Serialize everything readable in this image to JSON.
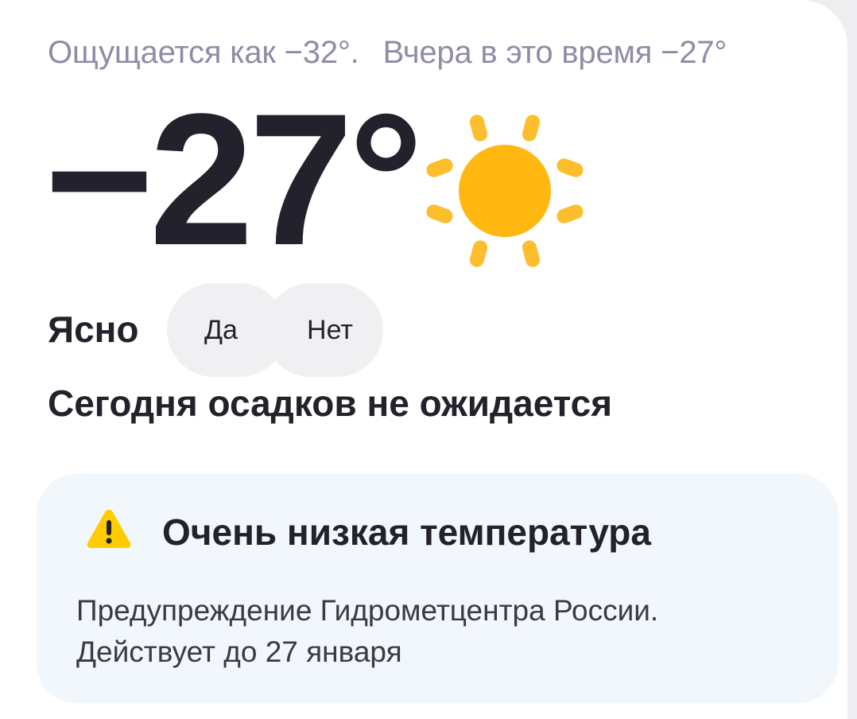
{
  "header": {
    "feels_like": "Ощущается как −32°.",
    "yesterday": "Вчера в это время −27°"
  },
  "current": {
    "temperature": "−27°",
    "condition": "Ясно",
    "icon": "sun-icon",
    "precipitation": "Сегодня осадков не ожидается"
  },
  "feedback": {
    "yes_label": "Да",
    "no_label": "Нет"
  },
  "alert": {
    "icon": "warning-icon",
    "title": "Очень низкая температура",
    "line1": "Предупреждение Гидрометцентра России.",
    "line2": "Действует до 27 января"
  },
  "colors": {
    "sun": "#FFB80F",
    "sun_rays": "#FDBE2E",
    "warning": "#FFCC00",
    "alert_bg": "#F1F7FB",
    "text_primary": "#23222C",
    "text_secondary": "#8F8CA6"
  }
}
